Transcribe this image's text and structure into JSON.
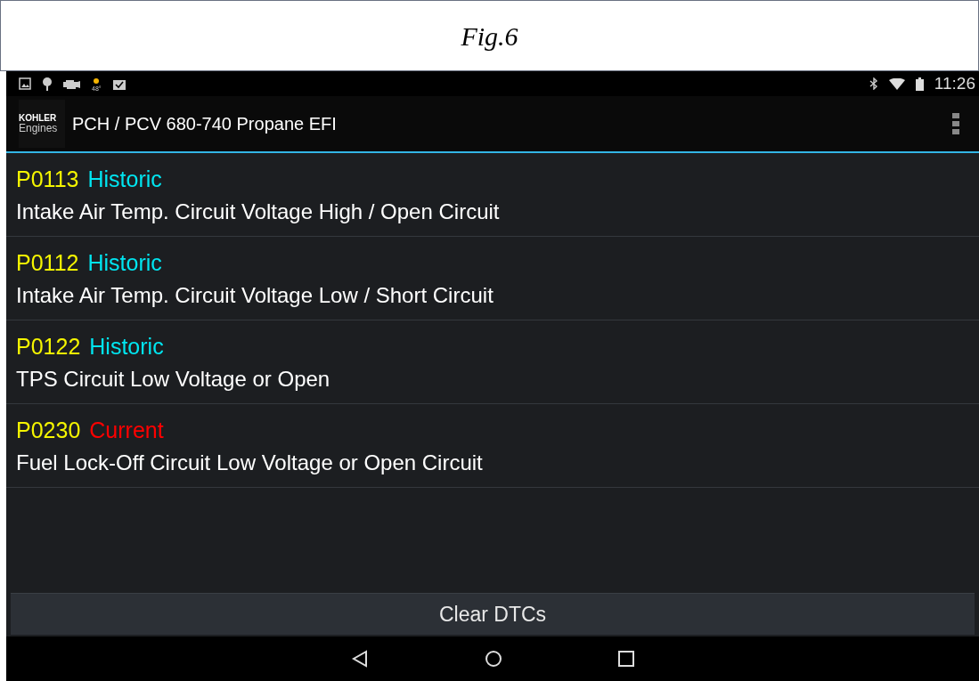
{
  "caption": "Fig.6",
  "status_bar": {
    "time": "11:26",
    "weather_temp": "48°"
  },
  "app_bar": {
    "logo_top": "KOHLER",
    "logo_bottom": "Engines",
    "title": "PCH / PCV 680-740 Propane EFI"
  },
  "dtcs": [
    {
      "code": "P0113",
      "status": "Historic",
      "color": "#00e5f0",
      "description": "Intake Air Temp. Circuit Voltage High / Open Circuit"
    },
    {
      "code": "P0112",
      "status": "Historic",
      "color": "#00e5f0",
      "description": "Intake Air Temp. Circuit Voltage Low / Short Circuit"
    },
    {
      "code": "P0122",
      "status": "Historic",
      "color": "#00e5f0",
      "description": "TPS Circuit Low Voltage or Open"
    },
    {
      "code": "P0230",
      "status": "Current",
      "color": "#ff0000",
      "description": "Fuel Lock-Off Circuit Low Voltage or Open Circuit"
    }
  ],
  "clear_button": "Clear DTCs"
}
